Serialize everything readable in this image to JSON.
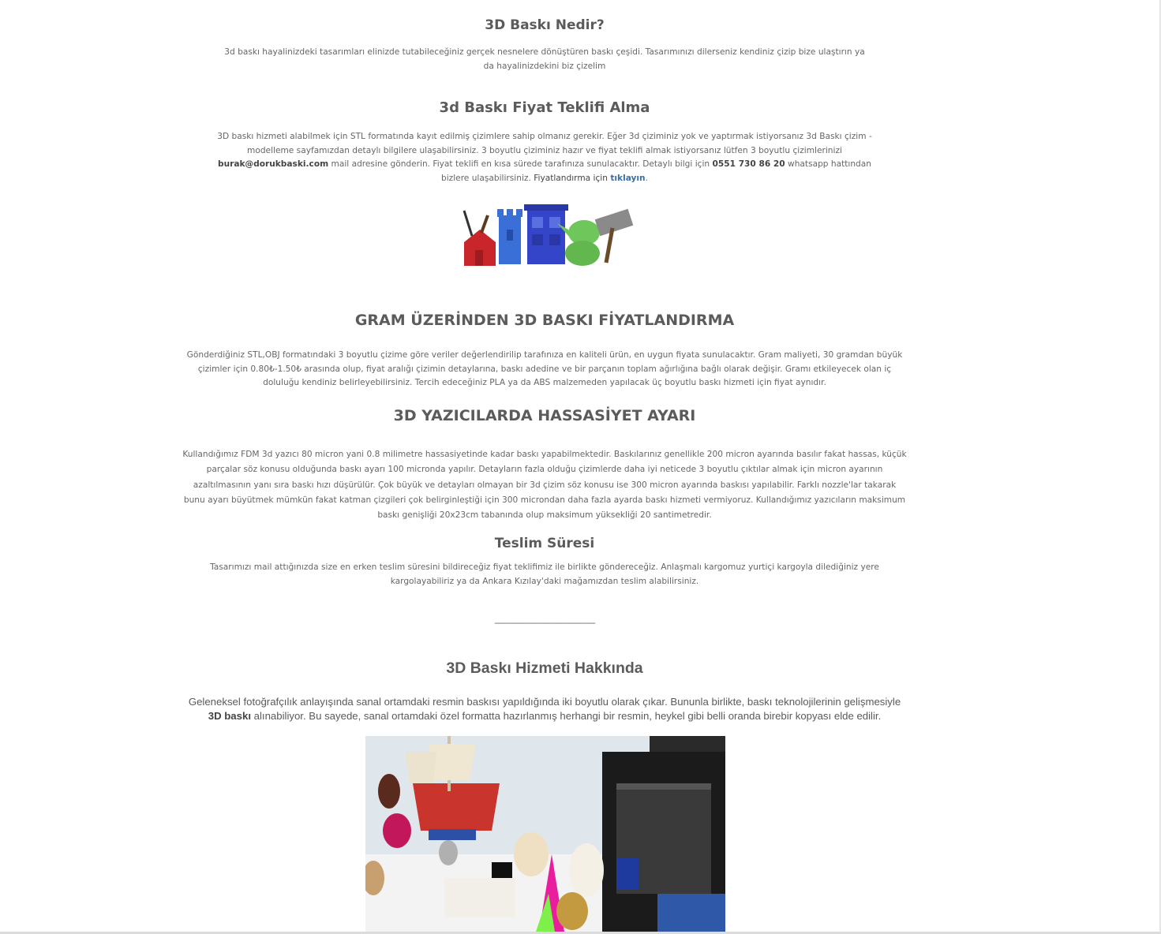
{
  "section1": {
    "title": "3D Baskı Nedir?",
    "text": "3d baskı hayalinizdeki tasarımları elinizde tutabileceğiniz gerçek nesnelere dönüştüren baskı çeşidi.  Tasarımınızı dilerseniz kendiniz çizip bize ulaştırın ya da hayalinizdekini biz çizelim"
  },
  "section2": {
    "title": "3d Baskı Fiyat Teklifi Alma",
    "text_a": "3D baskı hizmeti alabilmek için STL  formatında kayıt edilmiş çizimlere sahip olmanız gerekir. Eğer 3d çiziminiz yok ve yaptırmak istiyorsanız  3d Baskı çizim - modelleme sayfamızdan detaylı bilgilere ulaşabilirsiniz. 3 boyutlu çiziminiz hazır ve fiyat teklifi almak istiyorsanız lütfen 3 boyutlu çizimlerinizi ",
    "email": "burak@dorukbaski.com",
    "text_b": " mail  adresine gönderin. Fiyat teklifi en kısa sürede tarafınıza sunulacaktır. Detaylı bilgi için ",
    "phone": "0551 730 86 20",
    "text_c": " whatsapp hattından bizlere ulaşabilirsiniz. ",
    "pricing_prefix": "Fiyatlandırma için ",
    "link_text": "tıklayın",
    "link_suffix": "."
  },
  "section3": {
    "title": "GRAM ÜZERİNDEN 3D BASKI FİYATLANDIRMA",
    "text": "Gönderdiğiniz STL,OBJ formatındaki 3 boyutlu çizime göre veriler değerlendirilip tarafınıza en kaliteli ürün, en uygun fiyata sunulacaktır. Gram maliyeti, 30 gramdan büyük çizimler için 0.80₺-1.50₺ arasında olup, fiyat aralığı çizimin detaylarına, baskı adedine ve bir parçanın toplam ağırlığına bağlı olarak değişir. Gramı etkileyecek olan iç doluluğu kendiniz belirleyebilirsiniz. Tercih edeceğiniz PLA ya da ABS malzemeden yapılacak üç boyutlu baskı hizmeti için fiyat aynıdır."
  },
  "section4": {
    "title": "3D YAZICILARDA HASSASİYET AYARI",
    "text": "Kullandığımız FDM 3d yazıcı 80 micron yani 0.8 milimetre hassasiyetinde kadar baskı yapabilmektedir.  Baskılarınız genellikle 200 micron ayarında basılır fakat hassas, küçük parçalar söz konusu olduğunda baskı ayarı 100 micronda yapılır. Detayların fazla olduğu çizimlerde daha iyi neticede 3 boyutlu çıktılar almak için micron ayarının azaltılmasının yanı sıra baskı hızı düşürülür. Çok büyük ve detayları olmayan bir 3d çizim söz konusu ise 300 micron ayarında baskısı yapılabilir. Farklı nozzle'lar takarak bunu ayarı büyütmek mümkün fakat katman çizgileri çok belirginleştiği için 300 microndan daha fazla ayarda baskı hizmeti vermiyoruz. Kullandığımız yazıcıların maksimum baskı genişliği 20x23cm tabanında olup maksimum yüksekliği 20 santimetredir."
  },
  "section5": {
    "title": "Teslim Süresi",
    "text": "Tasarımızı mail attığınızda size en erken teslim süresini bildireceğiz fiyat teklifimiz ile birlikte göndereceğiz. Anlaşmalı kargomuz yurtiçi kargoyla dilediğiniz yere kargolayabiliriz ya da Ankara Kızılay'daki mağamızdan teslim alabilirsiniz."
  },
  "divider": "----------------------------------------------",
  "section6": {
    "title": "3D Baskı Hizmeti Hakkında",
    "text_a": "Geleneksel fotoğrafçılık anlayışında sanal ortamdaki resmin baskısı yapıldığında iki boyutlu olarak çıkar. Bununla birlikte, baskı teknolojilerinin gelişmesiyle ",
    "bold": "3D baskı",
    "text_b": " alınabiliyor. Bu sayede, sanal ortamdaki özel formatta hazırlanmış herhangi bir resmin, heykel gibi belli oranda birebir kopyası elde edilir."
  }
}
